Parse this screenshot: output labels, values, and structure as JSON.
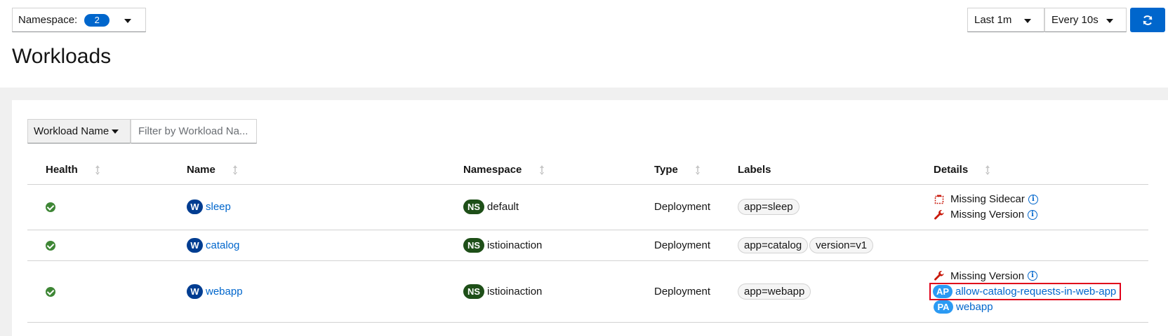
{
  "header": {
    "namespace_label": "Namespace:",
    "namespace_count": "2",
    "duration": "Last 1m",
    "refresh_interval": "Every 10s"
  },
  "page": {
    "title": "Workloads"
  },
  "filter": {
    "type_label": "Workload Name",
    "placeholder": "Filter by Workload Na..."
  },
  "table": {
    "columns": [
      "Health",
      "Name",
      "Namespace",
      "Type",
      "Labels",
      "Details"
    ],
    "rows": [
      {
        "health": "healthy",
        "name_badge": "W",
        "name": "sleep",
        "ns_badge": "NS",
        "namespace": "default",
        "type": "Deployment",
        "labels": [
          "app=sleep"
        ],
        "details": [
          {
            "icon": "missing-sidecar-icon",
            "text": "Missing Sidecar",
            "info": true
          },
          {
            "icon": "wrench-icon",
            "text": "Missing Version",
            "info": true
          }
        ]
      },
      {
        "health": "healthy",
        "name_badge": "W",
        "name": "catalog",
        "ns_badge": "NS",
        "namespace": "istioinaction",
        "type": "Deployment",
        "labels": [
          "app=catalog",
          "version=v1"
        ],
        "details": []
      },
      {
        "health": "healthy",
        "name_badge": "W",
        "name": "webapp",
        "ns_badge": "NS",
        "namespace": "istioinaction",
        "type": "Deployment",
        "labels": [
          "app=webapp"
        ],
        "details": [
          {
            "icon": "wrench-icon",
            "text": "Missing Version",
            "info": true
          },
          {
            "badge": "AP",
            "link": "allow-catalog-requests-in-web-app",
            "highlighted": true
          },
          {
            "badge": "PA",
            "link": "webapp"
          }
        ]
      }
    ]
  },
  "colors": {
    "primary": "#0066cc",
    "success": "#3e8635",
    "workload_badge": "#003d91",
    "namespace_badge": "#1e4f18",
    "policy_badge": "#2b9af3",
    "warning_red": "#c9190b",
    "highlight_border": "#e0001a"
  }
}
